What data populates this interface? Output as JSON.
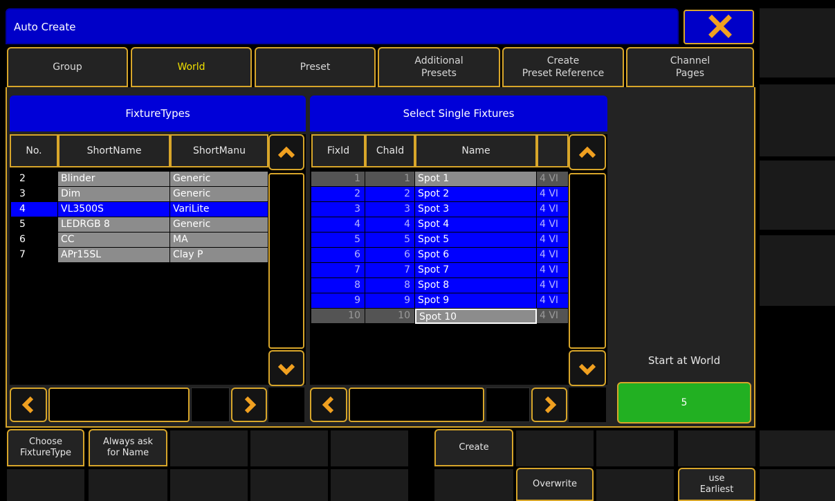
{
  "window": {
    "title": "Auto Create",
    "close_icon": "close-icon"
  },
  "tabs": [
    {
      "label": "Group"
    },
    {
      "label": "World"
    },
    {
      "label": "Preset"
    },
    {
      "label": "Additional\nPresets"
    },
    {
      "label": "Create\nPreset Reference"
    },
    {
      "label": "Channel\nPages"
    }
  ],
  "fixture_types": {
    "title": "FixtureTypes",
    "columns": [
      "No.",
      "ShortName",
      "ShortManu"
    ],
    "rows": [
      {
        "no": "2",
        "short_name": "Blinder",
        "short_manu": "Generic"
      },
      {
        "no": "3",
        "short_name": "Dim",
        "short_manu": "Generic"
      },
      {
        "no": "4",
        "short_name": "VL3500S",
        "short_manu": "VariLite"
      },
      {
        "no": "5",
        "short_name": "LEDRGB 8",
        "short_manu": "Generic"
      },
      {
        "no": "6",
        "short_name": "CC",
        "short_manu": "MA"
      },
      {
        "no": "7",
        "short_name": "APr15SL",
        "short_manu": "Clay P"
      }
    ]
  },
  "single_fixtures": {
    "title": "Select Single Fixtures",
    "columns": [
      "FixId",
      "ChaId",
      "Name",
      ""
    ],
    "rows": [
      {
        "fixid": "1",
        "chaid": "1",
        "name": "Spot 1",
        "extra": "4 VI"
      },
      {
        "fixid": "2",
        "chaid": "2",
        "name": "Spot 2",
        "extra": "4 VI"
      },
      {
        "fixid": "3",
        "chaid": "3",
        "name": "Spot 3",
        "extra": "4 VI"
      },
      {
        "fixid": "4",
        "chaid": "4",
        "name": "Spot 4",
        "extra": "4 VI"
      },
      {
        "fixid": "5",
        "chaid": "5",
        "name": "Spot 5",
        "extra": "4 VI"
      },
      {
        "fixid": "6",
        "chaid": "6",
        "name": "Spot 6",
        "extra": "4 VI"
      },
      {
        "fixid": "7",
        "chaid": "7",
        "name": "Spot 7",
        "extra": "4 VI"
      },
      {
        "fixid": "8",
        "chaid": "8",
        "name": "Spot 8",
        "extra": "4 VI"
      },
      {
        "fixid": "9",
        "chaid": "9",
        "name": "Spot 9",
        "extra": "4 VI"
      },
      {
        "fixid": "10",
        "chaid": "10",
        "name": "Spot 10",
        "extra": "4 VI"
      }
    ]
  },
  "start_at_world": {
    "label": "Start at World",
    "value": "5"
  },
  "bottom": {
    "choose_fixture_type": "Choose\nFixtureType",
    "always_ask": "Always ask\nfor Name",
    "create": "Create",
    "overwrite": "Overwrite",
    "use_earliest": "use\nEarliest"
  },
  "colors": {
    "accent": "#d8a62a",
    "title_blue": "#0000c8",
    "selected_blue": "#0000ff",
    "world_green": "#22b022"
  }
}
